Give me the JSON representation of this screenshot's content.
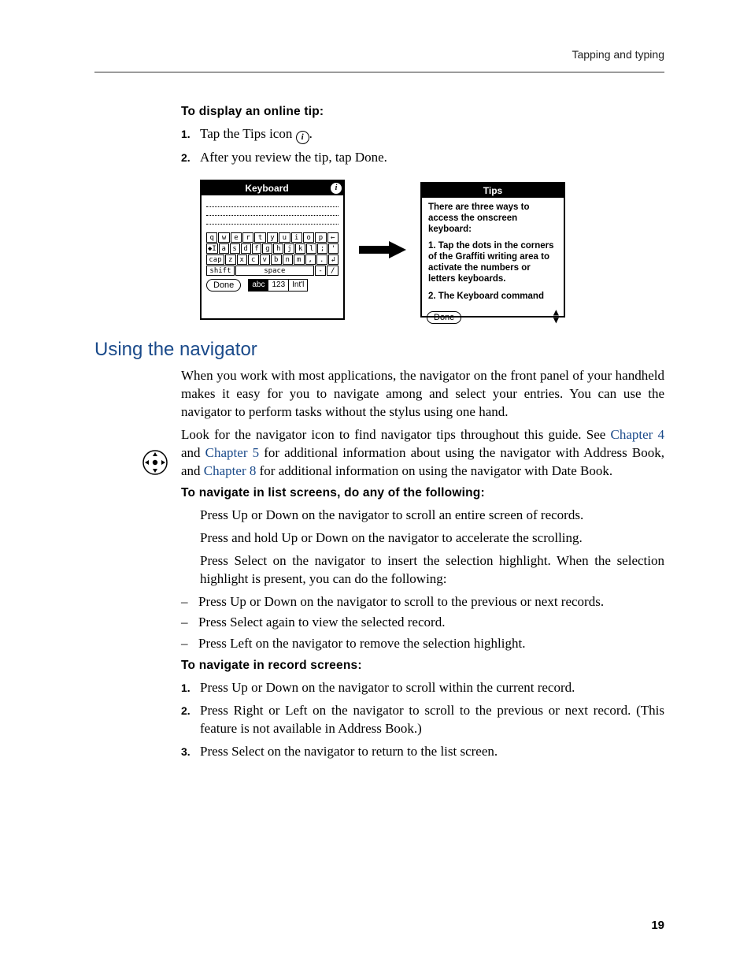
{
  "running_head": "Tapping and typing",
  "page_number": "19",
  "sec1": {
    "heading": "To display an online tip:",
    "steps": [
      {
        "n": "1.",
        "before": "Tap the Tips icon ",
        "after": "."
      },
      {
        "n": "2.",
        "text": "After you review the tip, tap Done."
      }
    ]
  },
  "fig": {
    "keyboard": {
      "title": "Keyboard",
      "row1": [
        "q",
        "w",
        "e",
        "r",
        "t",
        "y",
        "u",
        "i",
        "o",
        "p",
        "←"
      ],
      "row2_lead": "◆I",
      "row2": [
        "a",
        "s",
        "d",
        "f",
        "g",
        "h",
        "j",
        "k",
        "l",
        ";",
        "'"
      ],
      "row3_lead": "cap",
      "row3": [
        "z",
        "x",
        "c",
        "v",
        "b",
        "n",
        "m",
        ",",
        ".",
        "↲"
      ],
      "row4_shift": "shift",
      "row4_space": "space",
      "row4_dash": "-",
      "row4_slash": "/",
      "done": "Done",
      "seg": {
        "abc": "abc",
        "n123": "123",
        "intl": "Int'l"
      }
    },
    "tips": {
      "title": "Tips",
      "p1": "There are three ways to access the onscreen keyboard:",
      "p2": "1. Tap the dots in the corners of the Graffiti writing area to activate the numbers or letters keyboards.",
      "p3": "2. The Keyboard command",
      "done": "Done"
    }
  },
  "sec2": {
    "heading": "Using the navigator",
    "para1": "When you work with most applications, the navigator on the front panel of your handheld makes it easy for you to navigate among and select your entries. You can use the navigator to perform tasks without the stylus using one hand.",
    "para2_a": "Look for the navigator icon to find navigator tips throughout this guide. See ",
    "link_ch4": "Chapter 4",
    "para2_b": " and ",
    "link_ch5": "Chapter 5",
    "para2_c": " for additional information about using the navigator with Address Book, and ",
    "link_ch8": "Chapter 8",
    "para2_d": " for additional information on using the navigator with Date Book.",
    "list_heading": "To navigate in list screens, do any of the following:",
    "bullets": [
      "Press Up or Down on the navigator to scroll an entire screen of records.",
      "Press and hold Up or Down on the navigator to accelerate the scrolling.",
      "Press Select on the navigator to insert the selection highlight. When the selection highlight is present, you can do the following:"
    ],
    "sub_bullets": [
      "Press Up or Down on the navigator to scroll to the previous or next records.",
      "Press Select again to view the selected record.",
      "Press Left on the navigator to remove the selection highlight."
    ],
    "record_heading": "To navigate in record screens:",
    "record_steps": [
      {
        "n": "1.",
        "text": "Press Up or Down on the navigator to scroll within the current record."
      },
      {
        "n": "2.",
        "text": "Press Right or Left on the navigator to scroll to the previous or next record. (This feature is not available in Address Book.)"
      },
      {
        "n": "3.",
        "text": "Press Select on the navigator to return to the list screen."
      }
    ]
  }
}
